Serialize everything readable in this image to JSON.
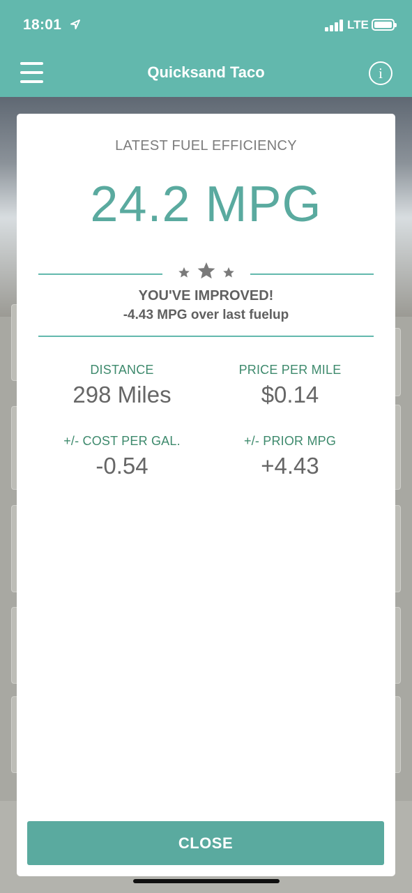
{
  "status_bar": {
    "time": "18:01",
    "network": "LTE"
  },
  "nav": {
    "title": "Quicksand Taco",
    "info_label": "i"
  },
  "modal": {
    "heading": "LATEST FUEL EFFICIENCY",
    "mpg": "24.2 MPG",
    "stars": 3,
    "improved_title": "YOU'VE IMPROVED!",
    "improved_subtitle": "-4.43 MPG over last fuelup",
    "stats": [
      {
        "label": "DISTANCE",
        "value": "298 Miles"
      },
      {
        "label": "PRICE PER MILE",
        "value": "$0.14"
      },
      {
        "label": "+/- COST PER GAL.",
        "value": "-0.54"
      },
      {
        "label": "+/- PRIOR MPG",
        "value": "+4.43"
      }
    ],
    "close_label": "CLOSE"
  },
  "colors": {
    "accent": "#62b8ad",
    "stat_label": "#3e8a6d",
    "text_gray": "#666666"
  }
}
